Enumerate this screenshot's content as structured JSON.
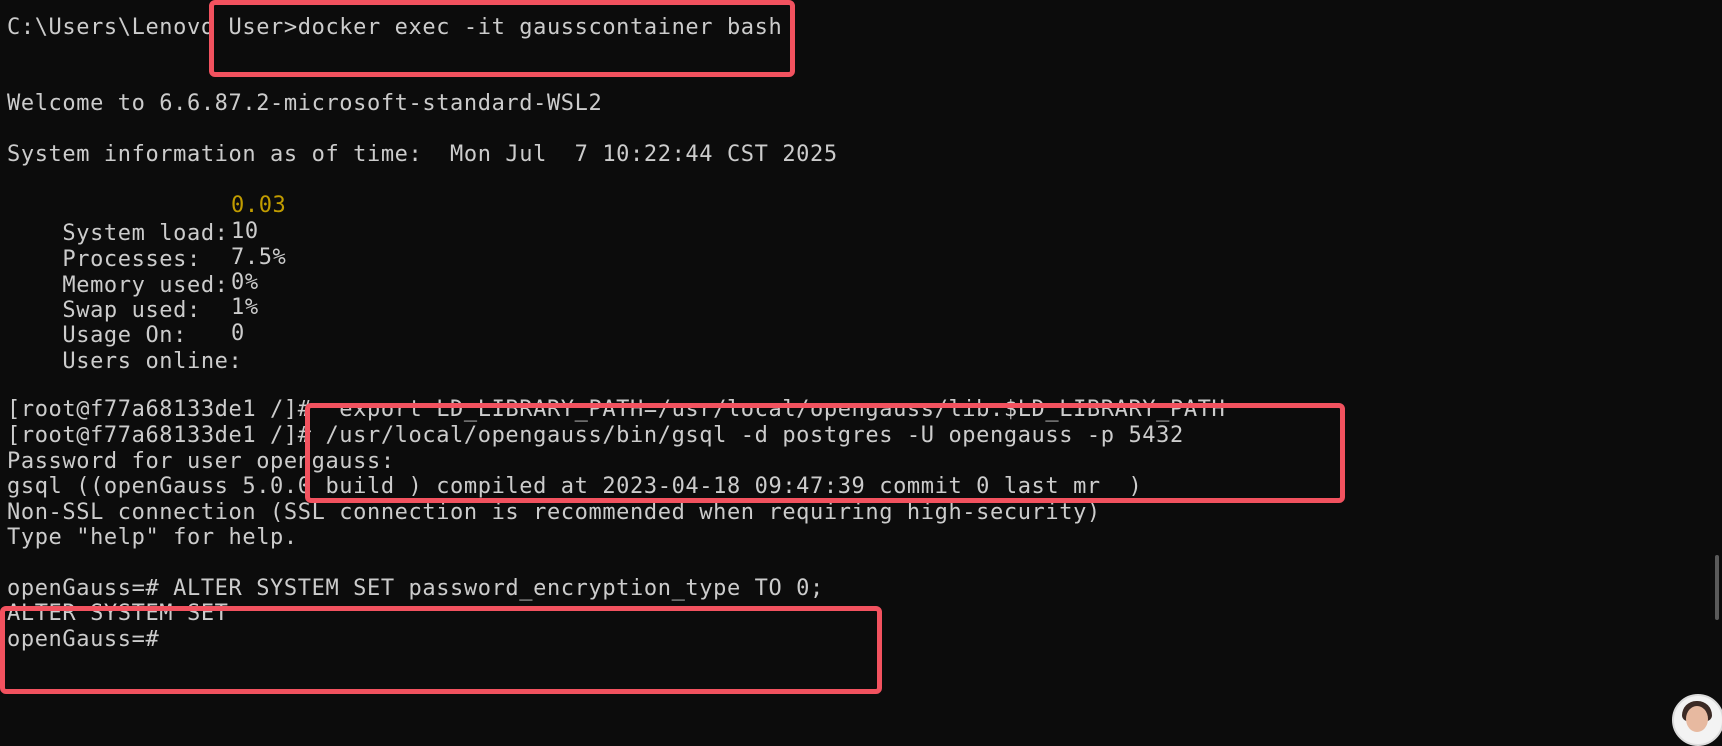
{
  "terminal": {
    "lines": {
      "prompt_docker": "C:\\Users\\Lenovo User>docker exec -it gausscontainer bash",
      "welcome": "Welcome to 6.6.87.2-microsoft-standard-WSL2",
      "sysinfo": "System information as of time:  Mon Jul  7 10:22:44 CST 2025",
      "root_export": "[root@f77a68133de1 /]#  export LD_LIBRARY_PATH=/usr/local/opengauss/lib:$LD_LIBRARY_PATH",
      "root_gsql": "[root@f77a68133de1 /]# /usr/local/opengauss/bin/gsql -d postgres -U opengauss -p 5432",
      "password_prompt": "Password for user opengauss:",
      "gsql_version": "gsql ((openGauss 5.0.0 build ) compiled at 2023-04-18 09:47:39 commit 0 last mr  )",
      "non_ssl": "Non-SSL connection (SSL connection is recommended when requiring high-security)",
      "help_hint": "Type \"help\" for help.",
      "alter_cmd": "openGauss=# ALTER SYSTEM SET password_encryption_type TO 0;",
      "alter_result": "ALTER SYSTEM SET",
      "final_prompt": "openGauss=#"
    },
    "stats": [
      {
        "label": "System load:",
        "value": "0.03"
      },
      {
        "label": "Processes:",
        "value": "10"
      },
      {
        "label": "Memory used:",
        "value": "7.5%"
      },
      {
        "label": "Swap used:",
        "value": "0%"
      },
      {
        "label": "Usage On:",
        "value": "1%"
      },
      {
        "label": "Users online:",
        "value": "0"
      }
    ]
  },
  "colors": {
    "background": "#0c0c0c",
    "text": "#cccccc",
    "highlight_box": "#f2525f",
    "load_value": "#c19c00"
  },
  "icons": {
    "avatar": "user-avatar-icon"
  }
}
